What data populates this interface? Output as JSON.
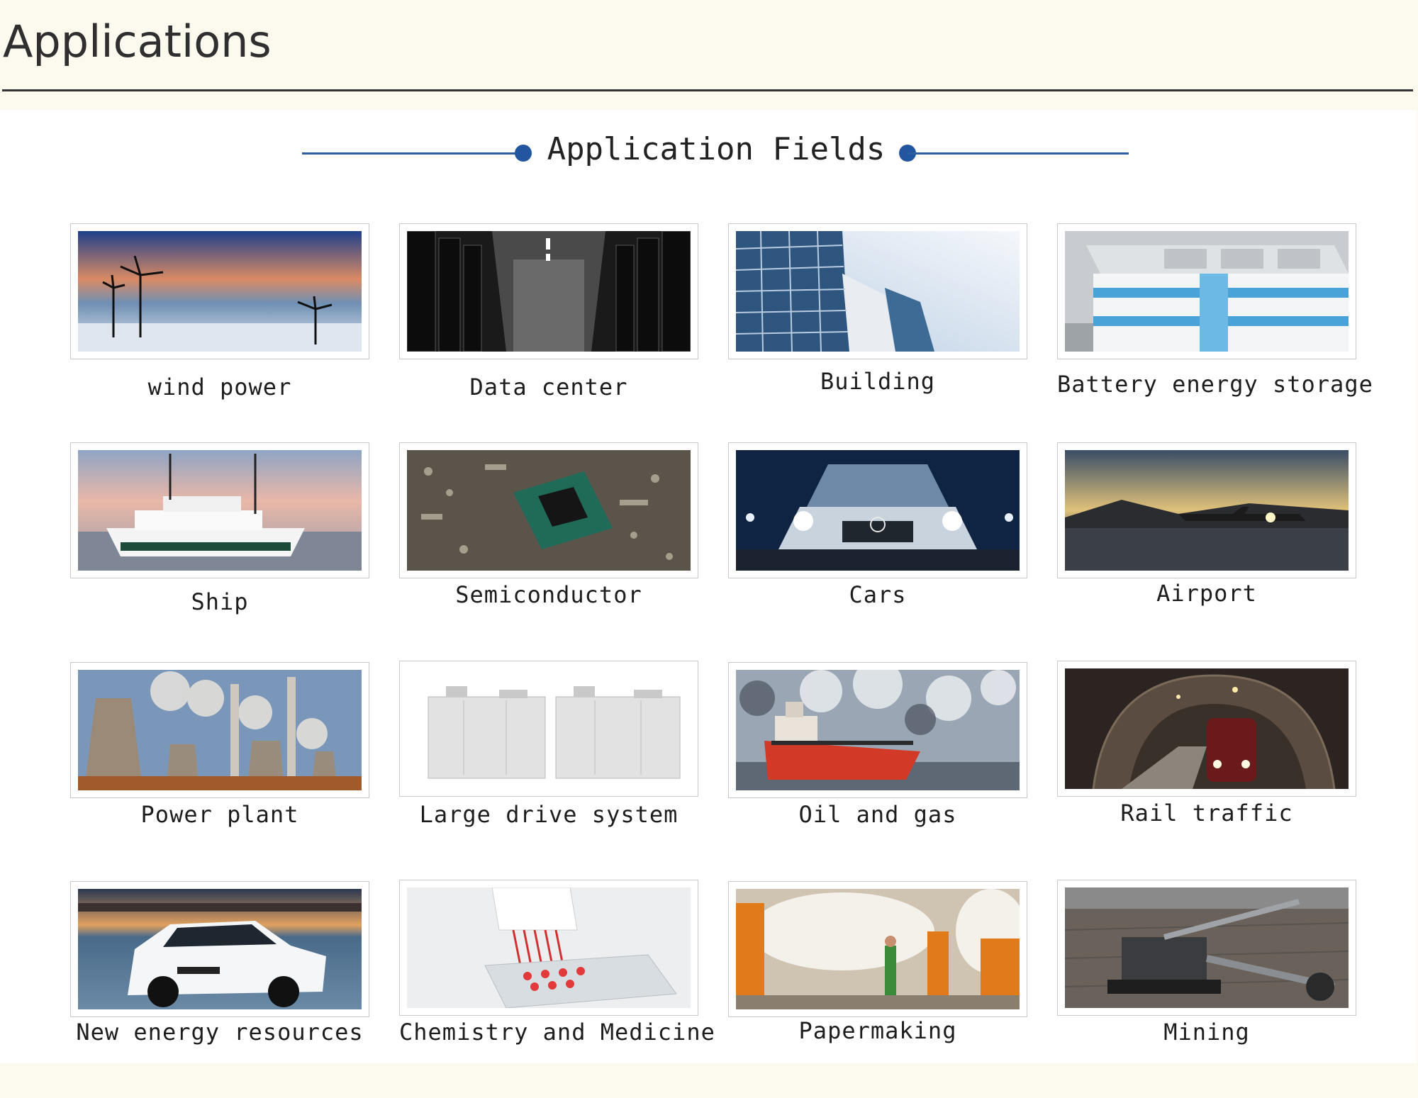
{
  "header": {
    "title": "Applications"
  },
  "section": {
    "heading": "Application Fields"
  },
  "fields": [
    {
      "label": "wind power",
      "image": "wind-turbines-photo"
    },
    {
      "label": "Data center",
      "image": "server-room-photo"
    },
    {
      "label": "Building",
      "image": "office-building-photo"
    },
    {
      "label": "Battery energy storage",
      "image": "storage-facility-photo"
    },
    {
      "label": "Ship",
      "image": "ferry-ship-photo"
    },
    {
      "label": "Semiconductor",
      "image": "circuit-chip-photo"
    },
    {
      "label": "Cars",
      "image": "cars-headlights-photo"
    },
    {
      "label": "Airport",
      "image": "airplane-runway-photo"
    },
    {
      "label": "Power plant",
      "image": "cooling-towers-photo"
    },
    {
      "label": "Large drive system",
      "image": "drive-cabinets-photo"
    },
    {
      "label": "Oil and gas",
      "image": "tanker-ship-photo"
    },
    {
      "label": "Rail traffic",
      "image": "subway-train-photo"
    },
    {
      "label": "New energy resources",
      "image": "electric-car-photo"
    },
    {
      "label": "Chemistry and Medicine",
      "image": "lab-pipette-photo"
    },
    {
      "label": "Papermaking",
      "image": "paper-rolls-photo"
    },
    {
      "label": "Mining",
      "image": "mining-excavator-photo"
    }
  ]
}
